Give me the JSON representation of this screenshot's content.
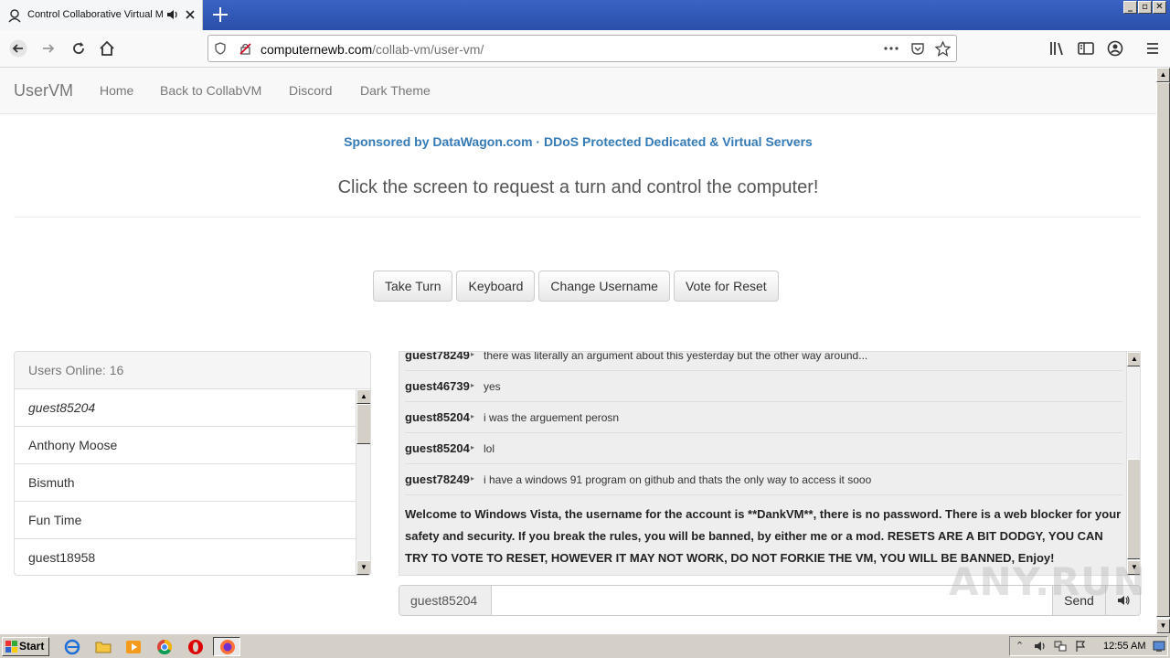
{
  "browser": {
    "tab_title": "Control Collaborative Virtual M",
    "url_host": "computernewb.com",
    "url_path": "/collab-vm/user-vm/",
    "window_buttons": [
      "_",
      "▫",
      "✕"
    ]
  },
  "site": {
    "brand": "UserVM",
    "nav": [
      "Home",
      "Back to CollabVM",
      "Discord",
      "Dark Theme"
    ],
    "sponsor": "Sponsored by DataWagon.com · DDoS Protected Dedicated & Virtual Servers",
    "headline": "Click the screen to request a turn and control the computer!",
    "buttons": {
      "take_turn": "Take Turn",
      "keyboard": "Keyboard",
      "change_username": "Change Username",
      "vote_reset": "Vote for Reset"
    }
  },
  "users": {
    "heading": "Users Online: 16",
    "list": [
      "guest85204",
      "Anthony Moose",
      "Bismuth",
      "Fun Time",
      "guest18958"
    ]
  },
  "chat": {
    "messages": [
      {
        "user": "guest78249",
        "text": "there was literally an argument about this yesterday but the other way around..."
      },
      {
        "user": "guest46739",
        "text": "yes"
      },
      {
        "user": "guest85204",
        "text": "i was the arguement perosn"
      },
      {
        "user": "guest85204",
        "text": "lol"
      },
      {
        "user": "guest78249",
        "text": "i have a windows 91 program on github and thats the only way to access it sooo"
      }
    ],
    "system_message": "Welcome to Windows Vista, the username for the account is **DankVM**, there is no password. There is a web blocker for your safety and security. If you break the rules, you will be banned, by either me or a mod. RESETS ARE A BIT DODGY, YOU CAN TRY TO VOTE TO RESET, HOWEVER IT MAY NOT WORK, DO NOT FORKIE THE VM, YOU WILL BE BANNED, Enjoy!",
    "input_username": "guest85204",
    "input_value": "",
    "send_label": "Send"
  },
  "watermark": "ANY.RUN",
  "taskbar": {
    "start_label": "Start",
    "clock": "12:55 AM"
  },
  "colors": {
    "link": "#337ab7",
    "titlebar": "#2a4fa8"
  }
}
